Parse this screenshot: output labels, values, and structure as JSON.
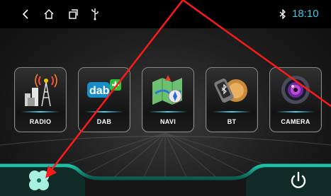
{
  "status_bar": {
    "time": "18:10",
    "icons": [
      "back-icon",
      "home-icon",
      "recents-icon",
      "usb-icon",
      "bluetooth-icon"
    ],
    "accent_color": "#3fc7e6"
  },
  "apps": [
    {
      "label": "RADIO",
      "icon": "radio-tower-icon"
    },
    {
      "label": "DAB",
      "icon": "dab-plus-icon"
    },
    {
      "label": "NAVI",
      "icon": "navigation-map-icon"
    },
    {
      "label": "BT",
      "icon": "bluetooth-phone-icon"
    },
    {
      "label": "CAMERA",
      "icon": "camera-lens-icon"
    }
  ],
  "dock": {
    "launcher_icon": "four-leaf-apps-icon",
    "power_icon": "power-icon",
    "accent_color": "#1fc0a8"
  },
  "annotation": {
    "color": "#ff1a1a",
    "arrows": 2
  }
}
